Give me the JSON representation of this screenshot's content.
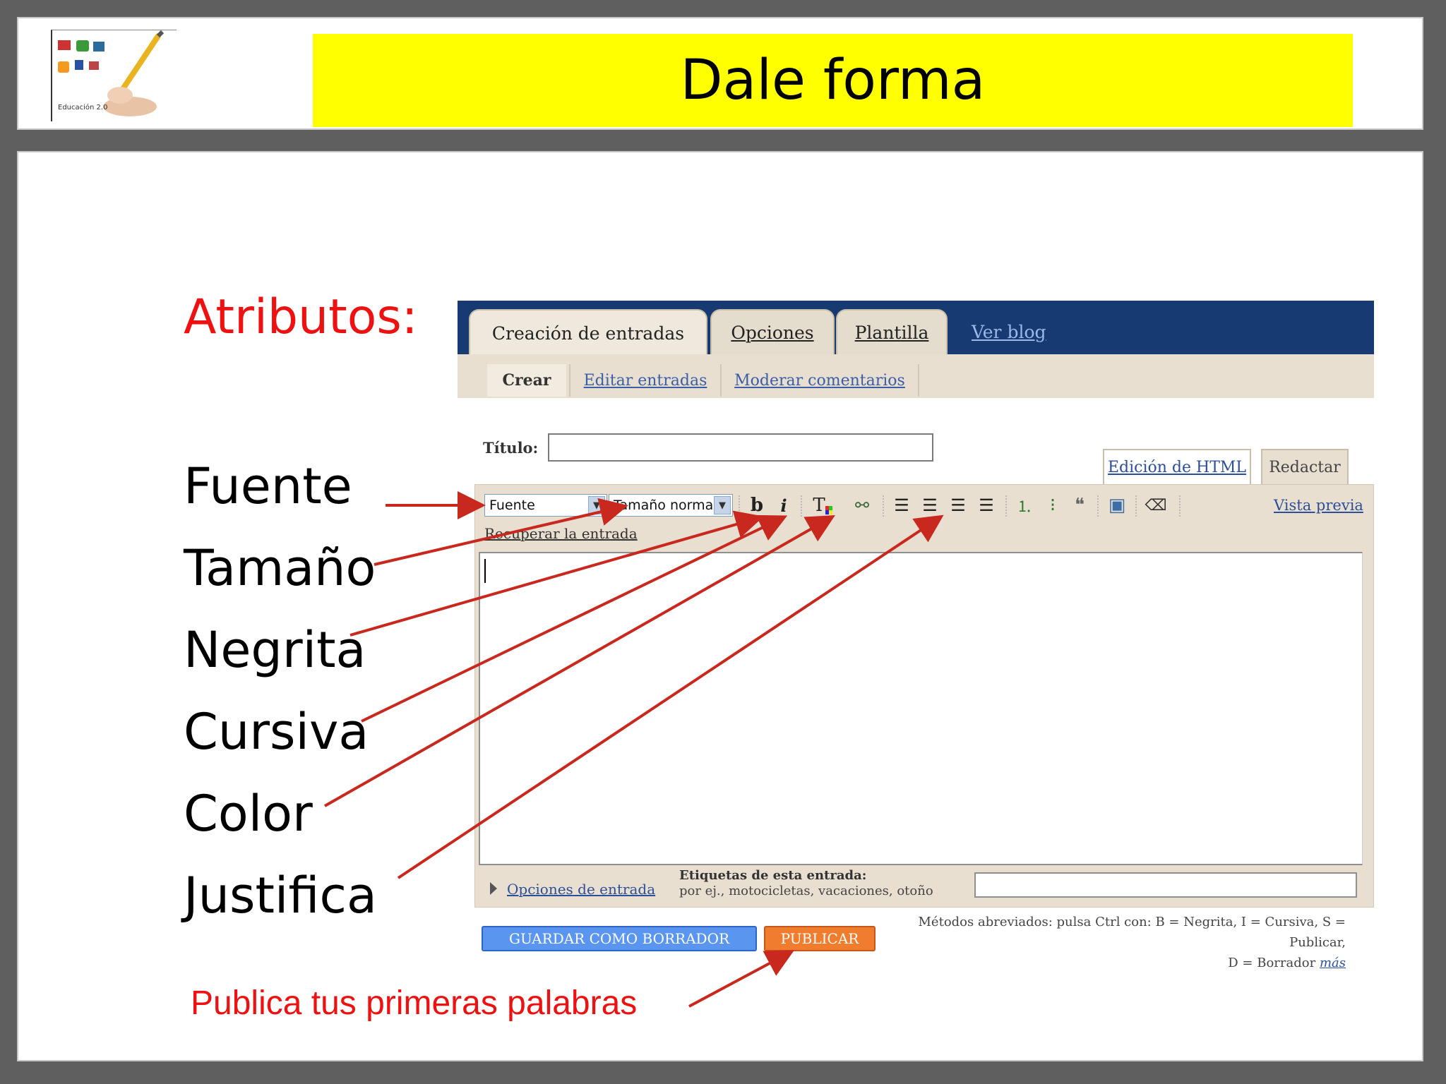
{
  "slide": {
    "title": "Dale forma",
    "atributos_label": "Atributos:",
    "attributes": [
      "Fuente",
      "Tamaño",
      "Negrita",
      "Cursiva",
      "Color",
      "Justifica"
    ],
    "publish_caption": "Publica tus primeras palabras",
    "accent_color": "#e11111",
    "title_bar_color": "#ffff00"
  },
  "logo": {
    "icons": [
      "youtube-icon",
      "blogger-icon",
      "slideshare-icon",
      "rss-icon",
      "facebook-icon",
      "delicious-icon"
    ],
    "caption": "Educación 2.0"
  },
  "blogger": {
    "tabs": {
      "creacion": "Creación de entradas",
      "opciones": "Opciones",
      "plantilla": "Plantilla",
      "ver_blog": "Ver blog"
    },
    "subnav": {
      "crear": "Crear",
      "editar": "Editar entradas",
      "moderar": "Moderar comentarios"
    },
    "titulo_label": "Título:",
    "titulo_value": "",
    "editor_tabs": {
      "html": "Edición de HTML",
      "redactar": "Redactar"
    },
    "toolbar": {
      "font_select": "Fuente",
      "size_select": "Tamaño normal",
      "bold": "b",
      "italic": "i",
      "color": "T",
      "link": "⚯",
      "align_left": "☰",
      "align_center": "☰",
      "align_right": "☰",
      "align_justify": "☰",
      "ordered_list": "⒈",
      "bullet_list": "⁝",
      "blockquote": "❝",
      "image": "▣",
      "eraser": "⌫",
      "vista_previa": "Vista previa"
    },
    "recuperar": "Recuperar la entrada",
    "opciones_entrada": "Opciones de entrada",
    "etiquetas_title": "Etiquetas de esta entrada:",
    "etiquetas_hint": "por ej., motocicletas, vacaciones, otoño",
    "etiquetas_value": "",
    "buttons": {
      "guardar": "GUARDAR COMO BORRADOR",
      "publicar": "PUBLICAR"
    },
    "shortcuts_line1": "Métodos abreviados: pulsa Ctrl con: B = Negrita, I = Cursiva, S = Publicar,",
    "shortcuts_line2": "D = Borrador",
    "shortcuts_more": "más"
  }
}
